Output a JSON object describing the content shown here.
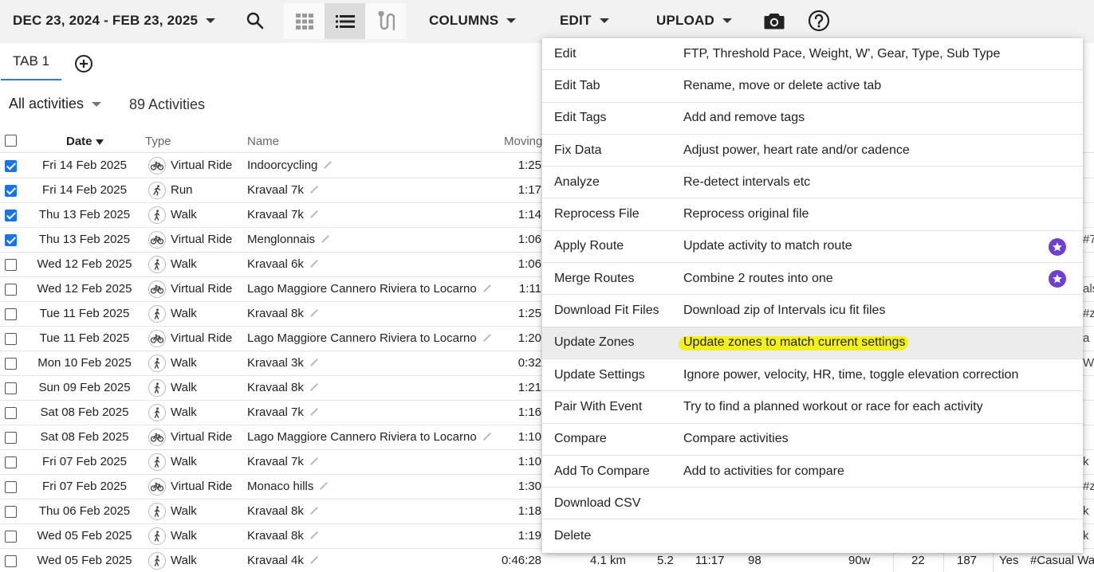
{
  "toolbar": {
    "date_range": "DEC 23, 2024 - FEB 23, 2025",
    "columns_label": "COLUMNS",
    "edit_label": "EDIT",
    "upload_label": "UPLOAD",
    "icons": [
      "search-icon",
      "grid-view-icon",
      "list-view-icon",
      "route-view-icon",
      "camera-icon",
      "help-icon"
    ]
  },
  "tabs": {
    "items": [
      {
        "label": "TAB 1"
      }
    ],
    "add_icon": "plus-circle-icon"
  },
  "filter": {
    "selected": "All activities",
    "count_label": "89 Activities"
  },
  "table": {
    "headers": {
      "date": "Date",
      "type": "Type",
      "name": "Name",
      "moving": "Moving"
    },
    "rows": [
      {
        "checked": true,
        "date": "Fri 14 Feb 2025",
        "type": "Virtual Ride",
        "icon": "bike",
        "name": "Indoorcycling",
        "moving": "1:25",
        "edge": ""
      },
      {
        "checked": true,
        "date": "Fri 14 Feb 2025",
        "type": "Run",
        "icon": "run",
        "name": "Kravaal 7k",
        "moving": "1:17",
        "edge": ""
      },
      {
        "checked": true,
        "date": "Thu 13 Feb 2025",
        "type": "Walk",
        "icon": "walk",
        "name": "Kravaal 7k",
        "moving": "1:14",
        "edge": ""
      },
      {
        "checked": true,
        "date": "Thu 13 Feb 2025",
        "type": "Virtual Ride",
        "icon": "bike",
        "name": "Menglonnais",
        "moving": "1:06",
        "edge": "#7"
      },
      {
        "checked": false,
        "date": "Wed 12 Feb 2025",
        "type": "Walk",
        "icon": "walk",
        "name": "Kravaal 6k",
        "moving": "1:06",
        "edge": ""
      },
      {
        "checked": false,
        "date": "Wed 12 Feb 2025",
        "type": "Virtual Ride",
        "icon": "bike",
        "name": "Lago Maggiore Cannero Riviera to Locarno",
        "moving": "1:11",
        "edge": "als"
      },
      {
        "checked": false,
        "date": "Tue 11 Feb 2025",
        "type": "Walk",
        "icon": "walk",
        "name": "Kravaal 8k",
        "moving": "1:25",
        "edge": "#z"
      },
      {
        "checked": false,
        "date": "Tue 11 Feb 2025",
        "type": "Virtual Ride",
        "icon": "bike",
        "name": "Lago Maggiore Cannero Riviera to Locarno",
        "moving": "1:20",
        "edge": "a"
      },
      {
        "checked": false,
        "date": "Mon 10 Feb 2025",
        "type": "Walk",
        "icon": "walk",
        "name": "Kravaal 3k",
        "moving": "0:32",
        "edge": "Wa"
      },
      {
        "checked": false,
        "date": "Sun 09 Feb 2025",
        "type": "Walk",
        "icon": "walk",
        "name": "Kravaal 8k",
        "moving": "1:21",
        "edge": ""
      },
      {
        "checked": false,
        "date": "Sat 08 Feb 2025",
        "type": "Walk",
        "icon": "walk",
        "name": "Kravaal 7k",
        "moving": "1:16",
        "edge": ""
      },
      {
        "checked": false,
        "date": "Sat 08 Feb 2025",
        "type": "Virtual Ride",
        "icon": "bike",
        "name": "Lago Maggiore Cannero Riviera to Locarno",
        "moving": "1:10",
        "edge": ""
      },
      {
        "checked": false,
        "date": "Fri 07 Feb 2025",
        "type": "Walk",
        "icon": "walk",
        "name": "Kravaal 7k",
        "moving": "1:10",
        "edge": "k"
      },
      {
        "checked": false,
        "date": "Fri 07 Feb 2025",
        "type": "Virtual Ride",
        "icon": "bike",
        "name": "Monaco hills",
        "moving": "1:30",
        "edge": "#z"
      },
      {
        "checked": false,
        "date": "Thu 06 Feb 2025",
        "type": "Walk",
        "icon": "walk",
        "name": "Kravaal 8k",
        "moving": "1:18",
        "edge": "k"
      },
      {
        "checked": false,
        "date": "Wed 05 Feb 2025",
        "type": "Walk",
        "icon": "walk",
        "name": "Kravaal 8k",
        "moving": "1:19",
        "edge": "k"
      },
      {
        "checked": false,
        "date": "Wed 05 Feb 2025",
        "type": "Walk",
        "icon": "walk",
        "name": "Kravaal 4k",
        "moving": "0:46:28",
        "dist": "4.1 km",
        "pace": "5.2",
        "pace2": "11:17",
        "hr": "98",
        "power": "90w",
        "load": "22",
        "max": "187",
        "yes": "Yes",
        "tags": "#Casual Wal"
      }
    ]
  },
  "edit_menu": {
    "items": [
      {
        "label": "Edit",
        "desc": "FTP, Threshold Pace, Weight, W', Gear, Type, Sub Type",
        "premium": false
      },
      {
        "label": "Edit Tab",
        "desc": "Rename, move or delete active tab",
        "premium": false
      },
      {
        "label": "Edit Tags",
        "desc": "Add and remove tags",
        "premium": false
      },
      {
        "label": "Fix Data",
        "desc": "Adjust power, heart rate and/or cadence",
        "premium": false
      },
      {
        "label": "Analyze",
        "desc": "Re-detect intervals etc",
        "premium": false
      },
      {
        "label": "Reprocess File",
        "desc": "Reprocess original file",
        "premium": false
      },
      {
        "label": "Apply Route",
        "desc": "Update activity to match route",
        "premium": true
      },
      {
        "label": "Merge Routes",
        "desc": "Combine 2 routes into one",
        "premium": true
      },
      {
        "label": "Download Fit Files",
        "desc": "Download zip of Intervals icu fit files",
        "premium": false
      },
      {
        "label": "Update Zones",
        "desc": "Update zones to match current settings",
        "premium": false,
        "hover": true,
        "highlight": true
      },
      {
        "label": "Update Settings",
        "desc": "Ignore power, velocity, HR, time, toggle elevation correction",
        "premium": false
      },
      {
        "label": "Pair With Event",
        "desc": "Try to find a planned workout or race for each activity",
        "premium": false
      },
      {
        "label": "Compare",
        "desc": "Compare activities",
        "premium": false
      },
      {
        "label": "Add To Compare",
        "desc": "Add to activities for compare",
        "premium": false
      },
      {
        "label": "Download CSV",
        "desc": "",
        "premium": false
      },
      {
        "label": "Delete",
        "desc": "",
        "premium": false
      }
    ],
    "premium_icon": "star-badge-icon",
    "premium_color": "#6f3fcf",
    "highlight_color": "#f3f01c"
  },
  "colors": {
    "accent": "#1a73e8",
    "tab_underline": "#2d7bd6",
    "toolbar_bg": "#f2f2f2"
  }
}
